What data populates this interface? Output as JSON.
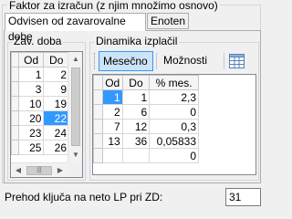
{
  "factor_group": {
    "title": "Faktor za izračun (z njim množimo osnovo)"
  },
  "tabs": [
    {
      "label": "Odvisen od zavarovalne dobe",
      "active": true
    },
    {
      "label": "Enoten",
      "active": false
    }
  ],
  "zav_doba": {
    "title": "Zav. doba",
    "columns": [
      "Od",
      "Do"
    ],
    "rows": [
      {
        "od": "1",
        "do": "2"
      },
      {
        "od": "3",
        "do": "9"
      },
      {
        "od": "10",
        "do": "19"
      },
      {
        "od": "20",
        "do": "22"
      },
      {
        "od": "23",
        "do": "24"
      },
      {
        "od": "25",
        "do": "26"
      }
    ],
    "selected_row": 3
  },
  "dinamika": {
    "title": "Dinamika izplačil",
    "toolbar": {
      "mesecno_label": "Mesečno",
      "moznosti_label": "Možnosti",
      "dropdown_arrow": "▾"
    },
    "columns": [
      "Od",
      "Do",
      "% mes."
    ],
    "rows": [
      {
        "od": "1",
        "do": "1",
        "pct": "2,3"
      },
      {
        "od": "2",
        "do": "6",
        "pct": "0"
      },
      {
        "od": "7",
        "do": "12",
        "pct": "0,3"
      },
      {
        "od": "13",
        "do": "36",
        "pct": "0,05833"
      },
      {
        "od": "",
        "do": "",
        "pct": "0"
      }
    ]
  },
  "footer": {
    "label": "Prehod ključa na neto LP pri ZD:",
    "value": "31"
  },
  "scroll": {
    "up": "▲",
    "down": "▼",
    "left": "◀",
    "right": "▶",
    "thumb_grip": "|||"
  }
}
